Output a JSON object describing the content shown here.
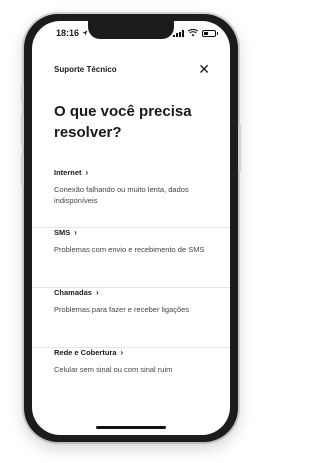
{
  "status_bar": {
    "time": "18:16"
  },
  "header": {
    "title": "Suporte Técnico",
    "close_glyph": "✕"
  },
  "page": {
    "title": "O que você precisa resolver?"
  },
  "items": [
    {
      "label": "Internet",
      "description": "Conexão falhando ou muito lenta, dados indisponíveis"
    },
    {
      "label": "SMS",
      "description": "Problemas com envio e recebimento de SMS"
    },
    {
      "label": "Chamadas",
      "description": "Problemas para fazer e receber ligações"
    },
    {
      "label": "Rede e Cobertura",
      "description": "Celular sem sinal ou com sinal ruim"
    }
  ],
  "chevron_glyph": "›"
}
